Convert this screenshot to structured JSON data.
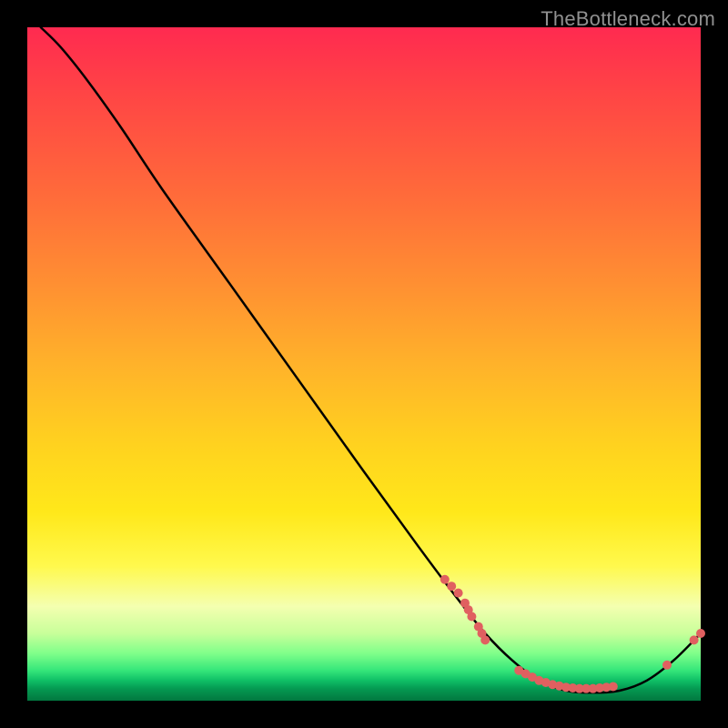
{
  "watermark": "TheBottleneck.com",
  "chart_data": {
    "type": "line",
    "title": "",
    "xlabel": "",
    "ylabel": "",
    "xlim": [
      0,
      100
    ],
    "ylim": [
      0,
      100
    ],
    "grid": false,
    "legend": false,
    "series": [
      {
        "name": "curve",
        "color": "#000000",
        "points_xy": [
          [
            2,
            100
          ],
          [
            5,
            97
          ],
          [
            9,
            92
          ],
          [
            14,
            85
          ],
          [
            20,
            76
          ],
          [
            30,
            62
          ],
          [
            40,
            48
          ],
          [
            50,
            34
          ],
          [
            58,
            23
          ],
          [
            64,
            15
          ],
          [
            68,
            10
          ],
          [
            72,
            6
          ],
          [
            76,
            3
          ],
          [
            80,
            1.5
          ],
          [
            84,
            1.2
          ],
          [
            88,
            1.5
          ],
          [
            92,
            3
          ],
          [
            96,
            6
          ],
          [
            100,
            10
          ]
        ]
      }
    ],
    "marker_clusters_xy": [
      [
        62,
        18
      ],
      [
        63,
        17
      ],
      [
        64,
        16
      ],
      [
        65,
        14.5
      ],
      [
        65.5,
        13.5
      ],
      [
        66,
        12.5
      ],
      [
        67,
        11
      ],
      [
        67.5,
        10
      ],
      [
        68,
        9
      ],
      [
        73,
        4.5
      ],
      [
        74,
        4
      ],
      [
        75,
        3.5
      ],
      [
        76,
        3
      ],
      [
        77,
        2.7
      ],
      [
        78,
        2.4
      ],
      [
        79,
        2.2
      ],
      [
        80,
        2
      ],
      [
        81,
        1.9
      ],
      [
        82,
        1.8
      ],
      [
        83,
        1.8
      ],
      [
        84,
        1.8
      ],
      [
        85,
        1.9
      ],
      [
        86,
        2
      ],
      [
        87,
        2.1
      ],
      [
        95,
        5.3
      ],
      [
        99,
        9
      ],
      [
        100,
        10
      ]
    ],
    "marker_color": "#e06060",
    "gradient_stops": [
      {
        "pos": 0.0,
        "color": "#ff2a50"
      },
      {
        "pos": 0.25,
        "color": "#ff6b3a"
      },
      {
        "pos": 0.5,
        "color": "#ffb22a"
      },
      {
        "pos": 0.72,
        "color": "#ffe81a"
      },
      {
        "pos": 0.86,
        "color": "#f4ffb0"
      },
      {
        "pos": 0.93,
        "color": "#7fff8a"
      },
      {
        "pos": 0.97,
        "color": "#0fbf66"
      },
      {
        "pos": 1.0,
        "color": "#02773f"
      }
    ]
  }
}
